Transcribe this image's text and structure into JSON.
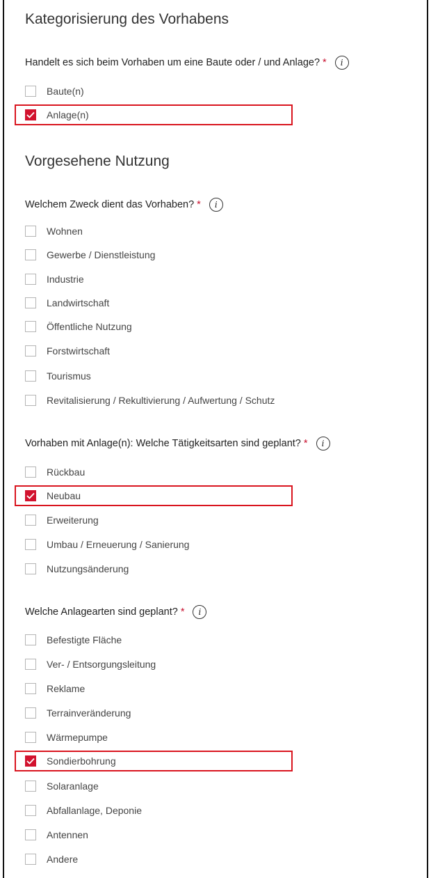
{
  "section1": {
    "title": "Kategorisierung des Vorhabens",
    "question": "Handelt es sich beim Vorhaben um eine Baute oder / und Anlage?",
    "required_mark": "*",
    "info": "i",
    "options": [
      {
        "label": "Baute(n)",
        "checked": false
      },
      {
        "label": "Anlage(n)",
        "checked": true
      }
    ]
  },
  "section2": {
    "title": "Vorgesehene Nutzung",
    "q1": {
      "question": "Welchem Zweck dient das Vorhaben?",
      "required_mark": "*",
      "info": "i",
      "options": [
        {
          "label": "Wohnen",
          "checked": false
        },
        {
          "label": "Gewerbe / Dienstleistung",
          "checked": false
        },
        {
          "label": "Industrie",
          "checked": false
        },
        {
          "label": "Landwirtschaft",
          "checked": false
        },
        {
          "label": "Öffentliche Nutzung",
          "checked": false
        },
        {
          "label": "Forstwirtschaft",
          "checked": false
        },
        {
          "label": "Tourismus",
          "checked": false
        },
        {
          "label": "Revitalisierung / Rekultivierung / Aufwertung / Schutz",
          "checked": false
        }
      ]
    },
    "q2": {
      "question": "Vorhaben mit Anlage(n): Welche Tätigkeitsarten sind geplant?",
      "required_mark": "*",
      "info": "i",
      "options": [
        {
          "label": "Rückbau",
          "checked": false
        },
        {
          "label": "Neubau",
          "checked": true
        },
        {
          "label": "Erweiterung",
          "checked": false
        },
        {
          "label": "Umbau / Erneuerung / Sanierung",
          "checked": false
        },
        {
          "label": "Nutzungsänderung",
          "checked": false
        }
      ]
    },
    "q3": {
      "question": "Welche Anlagearten sind geplant?",
      "required_mark": "*",
      "info": "i",
      "options": [
        {
          "label": "Befestigte Fläche",
          "checked": false
        },
        {
          "label": "Ver- / Entsorgungsleitung",
          "checked": false
        },
        {
          "label": "Reklame",
          "checked": false
        },
        {
          "label": "Terrainveränderung",
          "checked": false
        },
        {
          "label": "Wärmepumpe",
          "checked": false
        },
        {
          "label": "Sondierbohrung",
          "checked": true
        },
        {
          "label": "Solaranlage",
          "checked": false
        },
        {
          "label": "Abfallanlage, Deponie",
          "checked": false
        },
        {
          "label": "Antennen",
          "checked": false
        },
        {
          "label": "Andere",
          "checked": false
        }
      ]
    }
  },
  "colors": {
    "accent": "#d2122e",
    "highlight_border": "#d9141e",
    "required": "#c8102e"
  }
}
